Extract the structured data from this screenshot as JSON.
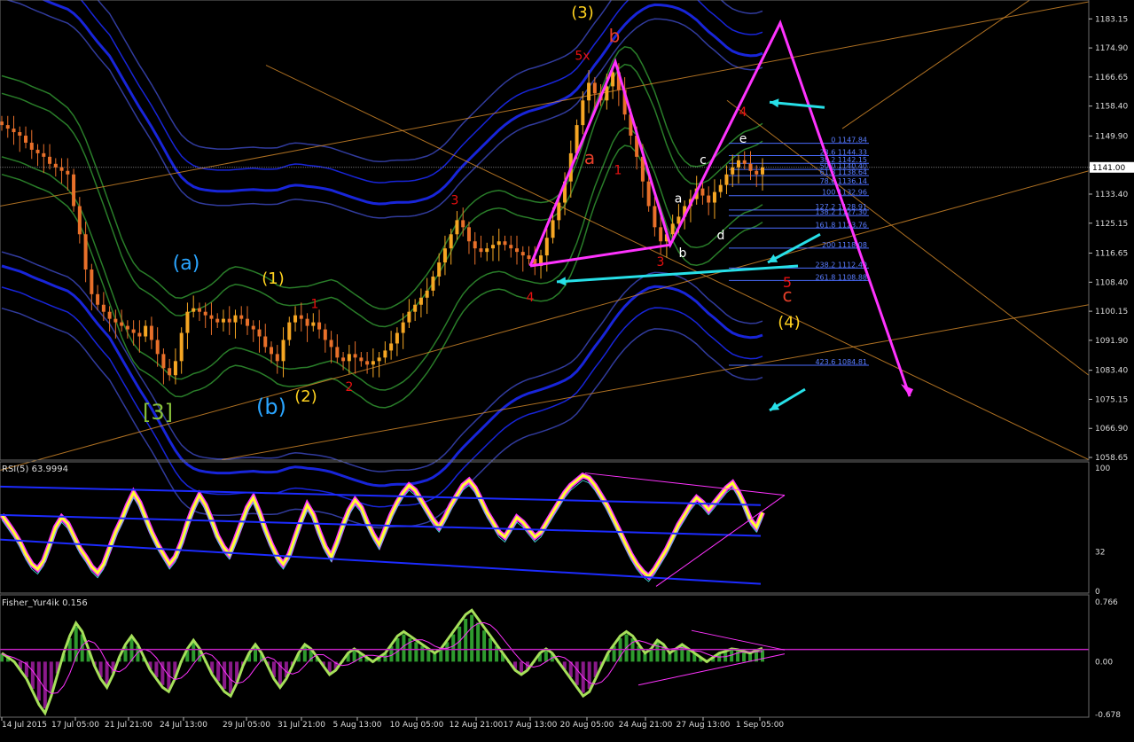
{
  "chart_data": [
    {
      "type": "candlestick",
      "title": "",
      "colors": {
        "background": "#000000",
        "bull": "#f5a623",
        "bear": "#e8702a",
        "band_blue": "#1c2bff",
        "band_green": "#2e8b2e",
        "fib": "#4a6cff",
        "pattern": "#ff33ff",
        "arrow": "#27e0e8",
        "trend": "#d98c2b"
      },
      "current_price_label": "1141.00",
      "ylim": [
        1058.65,
        1187.0
      ],
      "y_ticks": [
        "1183.15",
        "1174.90",
        "1166.65",
        "1158.40",
        "1149.90",
        "1141.00",
        "1133.40",
        "1125.15",
        "1116.65",
        "1108.40",
        "1100.15",
        "1091.90",
        "1083.40",
        "1075.15",
        "1066.90",
        "1058.65"
      ],
      "x_ticks": [
        "14 Jul 2015",
        "17 Jul 05:00",
        "21 Jul 21:00",
        "24 Jul 13:00",
        "29 Jul 05:00",
        "31 Jul 21:00",
        "5 Aug 13:00",
        "10 Aug 05:00",
        "12 Aug 21:00",
        "17 Aug 13:00",
        "20 Aug 05:00",
        "24 Aug 21:00",
        "27 Aug 13:00",
        "1 Sep 05:00"
      ],
      "fib_levels": [
        {
          "label": "0 1147.84",
          "value": 1147.84
        },
        {
          "label": "23.6 1144.33",
          "value": 1144.33
        },
        {
          "label": "38.2 1142.15",
          "value": 1142.15
        },
        {
          "label": "50.0 1140.40",
          "value": 1140.4
        },
        {
          "label": "61.8 1138.64",
          "value": 1138.64
        },
        {
          "label": "78.6 1136.14",
          "value": 1136.14
        },
        {
          "label": "100 1132.96",
          "value": 1132.96
        },
        {
          "label": "127.2 1128.91",
          "value": 1128.91
        },
        {
          "label": "138.2 1127.30",
          "value": 1127.3
        },
        {
          "label": "161.8 1123.76",
          "value": 1123.76
        },
        {
          "label": "200 1118.08",
          "value": 1118.08
        },
        {
          "label": "238.2 1112.40",
          "value": 1112.4
        },
        {
          "label": "261.8 1108.88",
          "value": 1108.88
        },
        {
          "label": "423.6 1084.81",
          "value": 1084.81
        }
      ],
      "close_series": [
        1153,
        1152,
        1151,
        1150,
        1148,
        1146,
        1145,
        1144,
        1142,
        1141,
        1140,
        1139,
        1130,
        1122,
        1112,
        1105,
        1102,
        1100,
        1098,
        1097,
        1096,
        1095,
        1094,
        1093,
        1096,
        1092,
        1088,
        1084,
        1082,
        1086,
        1094,
        1100,
        1101,
        1100,
        1099,
        1098,
        1097,
        1098,
        1097,
        1099,
        1098,
        1096,
        1095,
        1093,
        1090,
        1088,
        1086,
        1092,
        1097,
        1099,
        1098,
        1096,
        1097,
        1095,
        1092,
        1090,
        1087,
        1086,
        1088,
        1087,
        1086,
        1085,
        1086,
        1087,
        1089,
        1091,
        1094,
        1097,
        1100,
        1102,
        1104,
        1106,
        1110,
        1114,
        1118,
        1122,
        1126,
        1124,
        1120,
        1118,
        1117,
        1118,
        1119,
        1120,
        1119,
        1118,
        1117,
        1116,
        1115,
        1113,
        1116,
        1121,
        1126,
        1131,
        1137,
        1145,
        1153,
        1160,
        1165,
        1162,
        1160,
        1164,
        1168,
        1163,
        1156,
        1150,
        1144,
        1137,
        1130,
        1124,
        1120,
        1122,
        1125,
        1127,
        1130,
        1132,
        1135,
        1133,
        1131,
        1134,
        1136,
        1139,
        1141,
        1143,
        1142,
        1140,
        1139,
        1141
      ],
      "wave_labels": [
        {
          "text": "(3)",
          "price": 1183.5,
          "color": "#ffd21f",
          "size": 18
        },
        {
          "text": "b",
          "price": 1176.5,
          "color": "#e8402a",
          "size": 20
        },
        {
          "text": "5x",
          "price": 1171.5,
          "color": "#e81010",
          "size": 14
        },
        {
          "text": "a",
          "price": 1142,
          "color": "#e8402a",
          "size": 20
        },
        {
          "text": "1",
          "price": 1139,
          "color": "#e81010",
          "size": 14
        },
        {
          "text": "4",
          "price": 1155.5,
          "color": "#e81010",
          "size": 14
        },
        {
          "text": "e",
          "price": 1148,
          "color": "#ffffff",
          "size": 14
        },
        {
          "text": "c",
          "price": 1142,
          "color": "#ffffff",
          "size": 14
        },
        {
          "text": "a",
          "price": 1131,
          "color": "#ffffff",
          "size": 14
        },
        {
          "text": "d",
          "price": 1120.5,
          "color": "#ffffff",
          "size": 14
        },
        {
          "text": "b",
          "price": 1115.5,
          "color": "#ffffff",
          "size": 14
        },
        {
          "text": "3",
          "price": 1130.5,
          "color": "#e81010",
          "size": 14
        },
        {
          "text": "3",
          "price": 1113,
          "color": "#e81010",
          "size": 14
        },
        {
          "text": "4",
          "price": 1103,
          "color": "#e81010",
          "size": 14
        },
        {
          "text": "(a)",
          "price": 1112,
          "color": "#2aa5ff",
          "size": 22
        },
        {
          "text": "(1)",
          "price": 1108,
          "color": "#ffd21f",
          "size": 18
        },
        {
          "text": "1",
          "price": 1101,
          "color": "#e81010",
          "size": 14
        },
        {
          "text": "[3]",
          "price": 1069.5,
          "color": "#88c23a",
          "size": 24
        },
        {
          "text": "(b)",
          "price": 1071,
          "color": "#2aa5ff",
          "size": 24
        },
        {
          "text": "(2)",
          "price": 1074.5,
          "color": "#ffd21f",
          "size": 18
        },
        {
          "text": "2",
          "price": 1077.5,
          "color": "#e81010",
          "size": 14
        },
        {
          "text": "5",
          "price": 1107,
          "color": "#e81010",
          "size": 16
        },
        {
          "text": "c",
          "price": 1103,
          "color": "#e8402a",
          "size": 20
        },
        {
          "text": "(4)",
          "price": 1095.5,
          "color": "#ffd21f",
          "size": 18
        }
      ]
    },
    {
      "type": "line",
      "title": "RSI(5) 63.9994",
      "ylim": [
        0,
        100
      ],
      "y_ticks": [
        "100",
        "32",
        "0"
      ],
      "rsi_series": [
        62,
        55,
        48,
        40,
        30,
        22,
        18,
        25,
        38,
        52,
        60,
        55,
        45,
        35,
        28,
        20,
        15,
        22,
        35,
        48,
        58,
        70,
        80,
        72,
        60,
        48,
        38,
        30,
        22,
        28,
        40,
        55,
        68,
        78,
        70,
        58,
        45,
        36,
        30,
        42,
        55,
        68,
        76,
        64,
        50,
        38,
        28,
        22,
        30,
        44,
        58,
        70,
        62,
        48,
        36,
        28,
        40,
        54,
        66,
        74,
        68,
        56,
        46,
        38,
        50,
        62,
        72,
        80,
        86,
        82,
        74,
        66,
        58,
        52,
        60,
        70,
        78,
        86,
        90,
        84,
        74,
        64,
        56,
        48,
        44,
        52,
        60,
        56,
        50,
        44,
        48,
        56,
        64,
        72,
        80,
        86,
        90,
        94,
        92,
        86,
        78,
        70,
        60,
        50,
        40,
        30,
        22,
        16,
        12,
        18,
        26,
        34,
        44,
        54,
        62,
        70,
        76,
        72,
        66,
        72,
        78,
        84,
        88,
        80,
        70,
        58,
        52,
        64
      ]
    },
    {
      "type": "bar",
      "title": "Fisher_Yur4ik 0.156",
      "ylim": [
        -0.678,
        0.766
      ],
      "y_ticks": [
        "0.766",
        "0.00",
        "-0.678"
      ],
      "fisher_series": [
        0.1,
        0.05,
        0.0,
        -0.1,
        -0.2,
        -0.35,
        -0.5,
        -0.6,
        -0.4,
        -0.15,
        0.1,
        0.3,
        0.45,
        0.35,
        0.15,
        -0.05,
        -0.2,
        -0.3,
        -0.15,
        0.05,
        0.2,
        0.3,
        0.2,
        0.05,
        -0.1,
        -0.2,
        -0.3,
        -0.35,
        -0.2,
        0.0,
        0.15,
        0.25,
        0.15,
        0.0,
        -0.15,
        -0.25,
        -0.35,
        -0.4,
        -0.25,
        -0.05,
        0.1,
        0.2,
        0.1,
        -0.05,
        -0.2,
        -0.3,
        -0.2,
        -0.05,
        0.1,
        0.2,
        0.15,
        0.05,
        -0.05,
        -0.15,
        -0.1,
        0.0,
        0.1,
        0.15,
        0.1,
        0.05,
        0.0,
        0.05,
        0.1,
        0.2,
        0.3,
        0.35,
        0.3,
        0.25,
        0.2,
        0.15,
        0.1,
        0.15,
        0.25,
        0.35,
        0.45,
        0.55,
        0.6,
        0.5,
        0.4,
        0.3,
        0.2,
        0.1,
        0.0,
        -0.1,
        -0.15,
        -0.1,
        0.0,
        0.1,
        0.15,
        0.1,
        0.0,
        -0.1,
        -0.2,
        -0.3,
        -0.4,
        -0.35,
        -0.2,
        -0.05,
        0.1,
        0.2,
        0.3,
        0.35,
        0.3,
        0.2,
        0.1,
        0.15,
        0.25,
        0.2,
        0.1,
        0.15,
        0.2,
        0.15,
        0.1,
        0.05,
        0.0,
        0.05,
        0.1,
        0.12,
        0.15,
        0.14,
        0.12,
        0.1,
        0.13,
        0.156
      ]
    }
  ]
}
